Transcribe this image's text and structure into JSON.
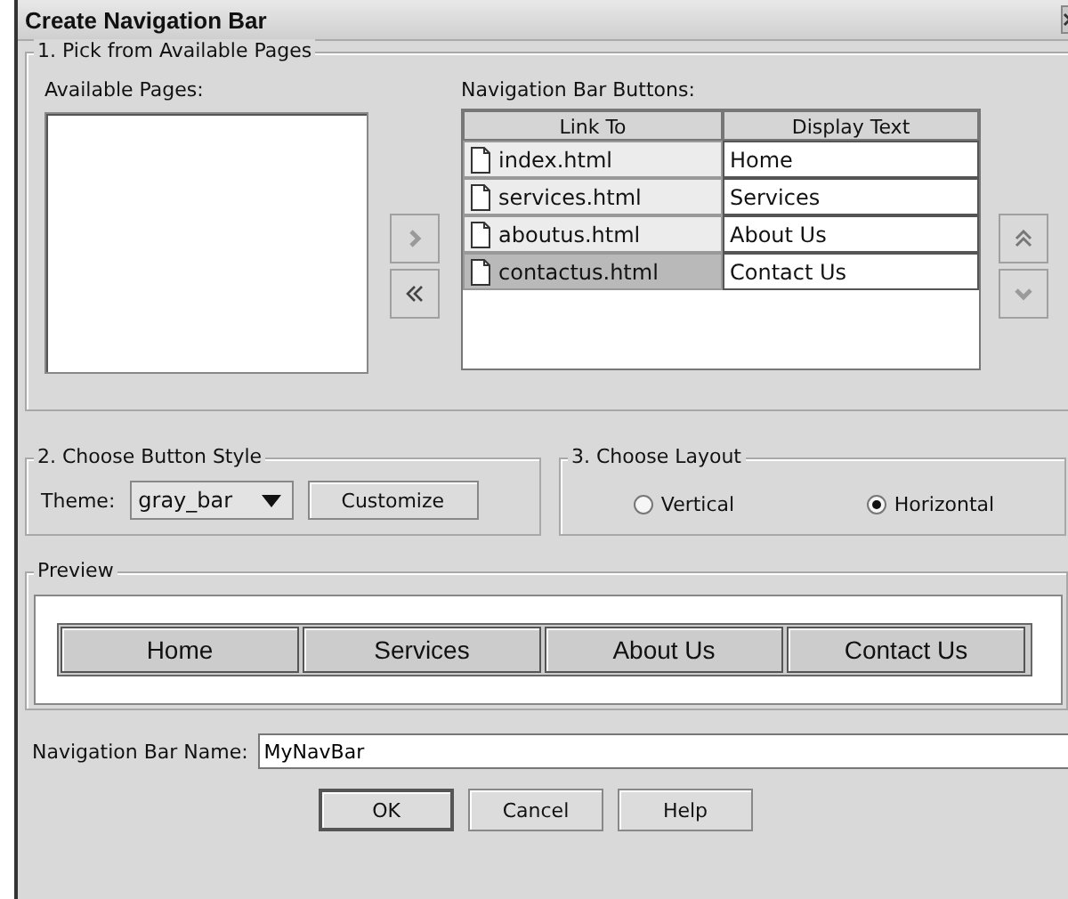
{
  "window": {
    "title": "Create Navigation Bar"
  },
  "pick_group": {
    "legend": "1. Pick from Available Pages",
    "available_label": "Available Pages:",
    "buttons_label": "Navigation Bar Buttons:",
    "columns": [
      "Link To",
      "Display Text"
    ],
    "rows": [
      {
        "link": "index.html",
        "text": "Home",
        "selected": false
      },
      {
        "link": "services.html",
        "text": "Services",
        "selected": false
      },
      {
        "link": "aboutus.html",
        "text": "About Us",
        "selected": false
      },
      {
        "link": "contactus.html",
        "text": "Contact Us",
        "selected": true
      }
    ]
  },
  "style_group": {
    "legend": "2. Choose Button Style",
    "theme_label": "Theme:",
    "theme_value": "gray_bar",
    "customize": "Customize"
  },
  "layout_group": {
    "legend": "3. Choose Layout",
    "options": [
      {
        "label": "Vertical",
        "selected": false
      },
      {
        "label": "Horizontal",
        "selected": true
      }
    ]
  },
  "preview": {
    "legend": "Preview",
    "buttons": [
      "Home",
      "Services",
      "About Us",
      "Contact Us"
    ]
  },
  "name_field": {
    "label": "Navigation Bar Name:",
    "value": "MyNavBar"
  },
  "buttons": [
    "OK",
    "Cancel",
    "Help"
  ]
}
